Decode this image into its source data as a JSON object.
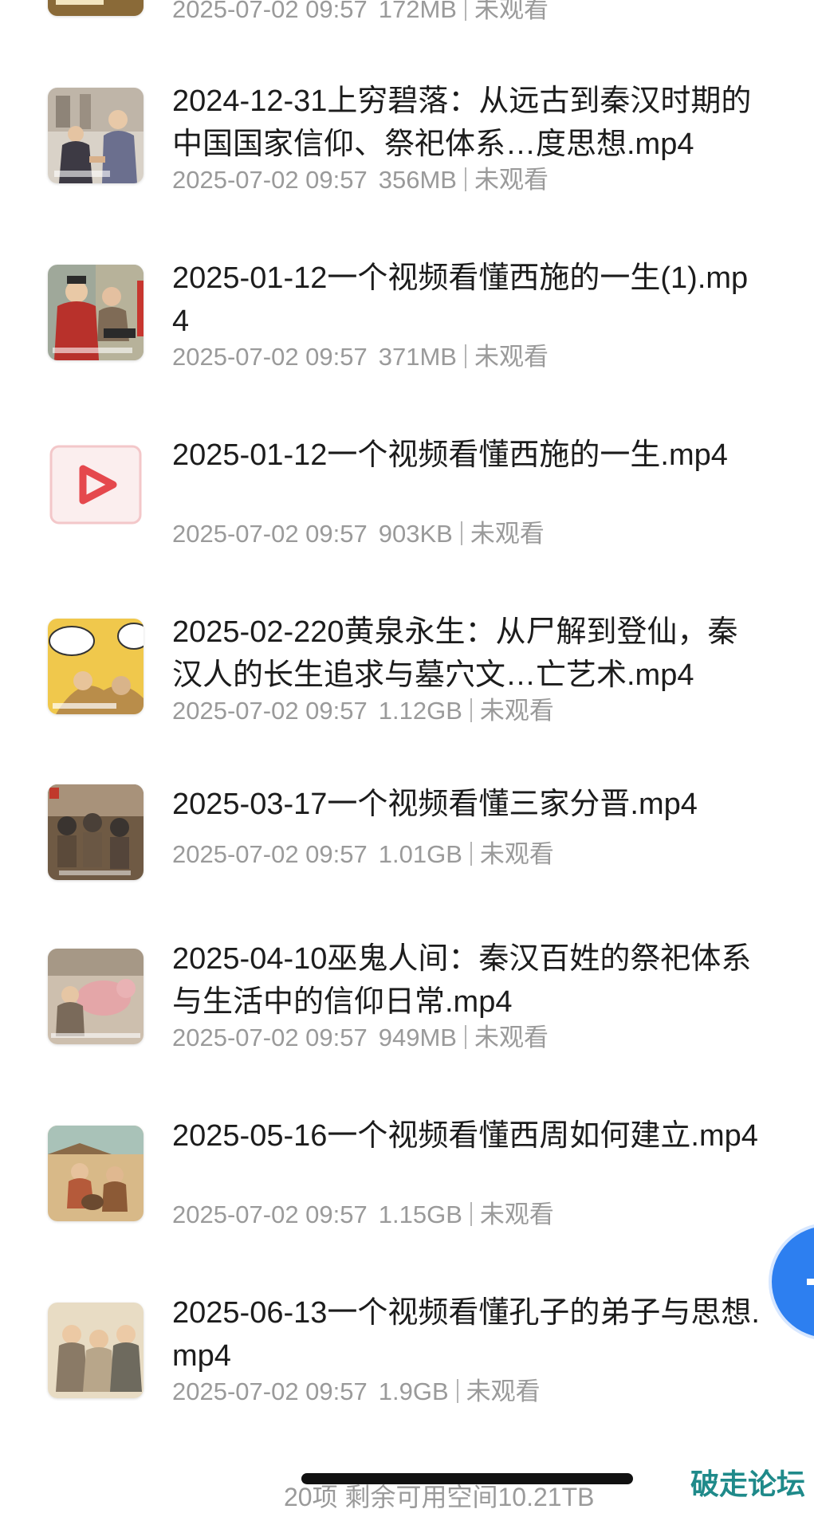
{
  "items": [
    {
      "name": "",
      "date": "2025-07-02 09:57",
      "size": "172MB",
      "status": "未观看",
      "thumb": "top-partial-thumb"
    },
    {
      "name": "2024-12-31上穷碧落：从远古到秦汉时期的中国国家信仰、祭祀体系…度思想.mp4",
      "date": "2025-07-02 09:57",
      "size": "356MB",
      "status": "未观看",
      "thumb": "video-thumbnail"
    },
    {
      "name": "2025-01-12一个视频看懂西施的一生(1).mp4",
      "date": "2025-07-02 09:57",
      "size": "371MB",
      "status": "未观看",
      "thumb": "video-thumbnail"
    },
    {
      "name": "2025-01-12一个视频看懂西施的一生.mp4",
      "date": "2025-07-02 09:57",
      "size": "903KB",
      "status": "未观看",
      "thumb": "video-file-play-icon"
    },
    {
      "name": "2025-02-220黄泉永生：从尸解到登仙，秦汉人的长生追求与墓穴文…亡艺术.mp4",
      "date": "2025-07-02 09:57",
      "size": "1.12GB",
      "status": "未观看",
      "thumb": "video-thumbnail"
    },
    {
      "name": "2025-03-17一个视频看懂三家分晋.mp4",
      "date": "2025-07-02 09:57",
      "size": "1.01GB",
      "status": "未观看",
      "thumb": "video-thumbnail"
    },
    {
      "name": "2025-04-10巫鬼人间：秦汉百姓的祭祀体系与生活中的信仰日常.mp4",
      "date": "2025-07-02 09:57",
      "size": "949MB",
      "status": "未观看",
      "thumb": "video-thumbnail"
    },
    {
      "name": "2025-05-16一个视频看懂西周如何建立.mp4",
      "date": "2025-07-02 09:57",
      "size": "1.15GB",
      "status": "未观看",
      "thumb": "video-thumbnail"
    },
    {
      "name": "2025-06-13一个视频看懂孔子的弟子与思想.mp4",
      "date": "2025-07-02 09:57",
      "size": "1.9GB",
      "status": "未观看",
      "thumb": "video-thumbnail"
    }
  ],
  "footer": {
    "summary": "20项 剩余可用空间10.21TB"
  },
  "watermark": {
    "text": "破走论坛"
  },
  "colors": {
    "accent": "#2d7ff0",
    "play_red": "#e5484d",
    "meta_gray": "#9a9a9a"
  }
}
